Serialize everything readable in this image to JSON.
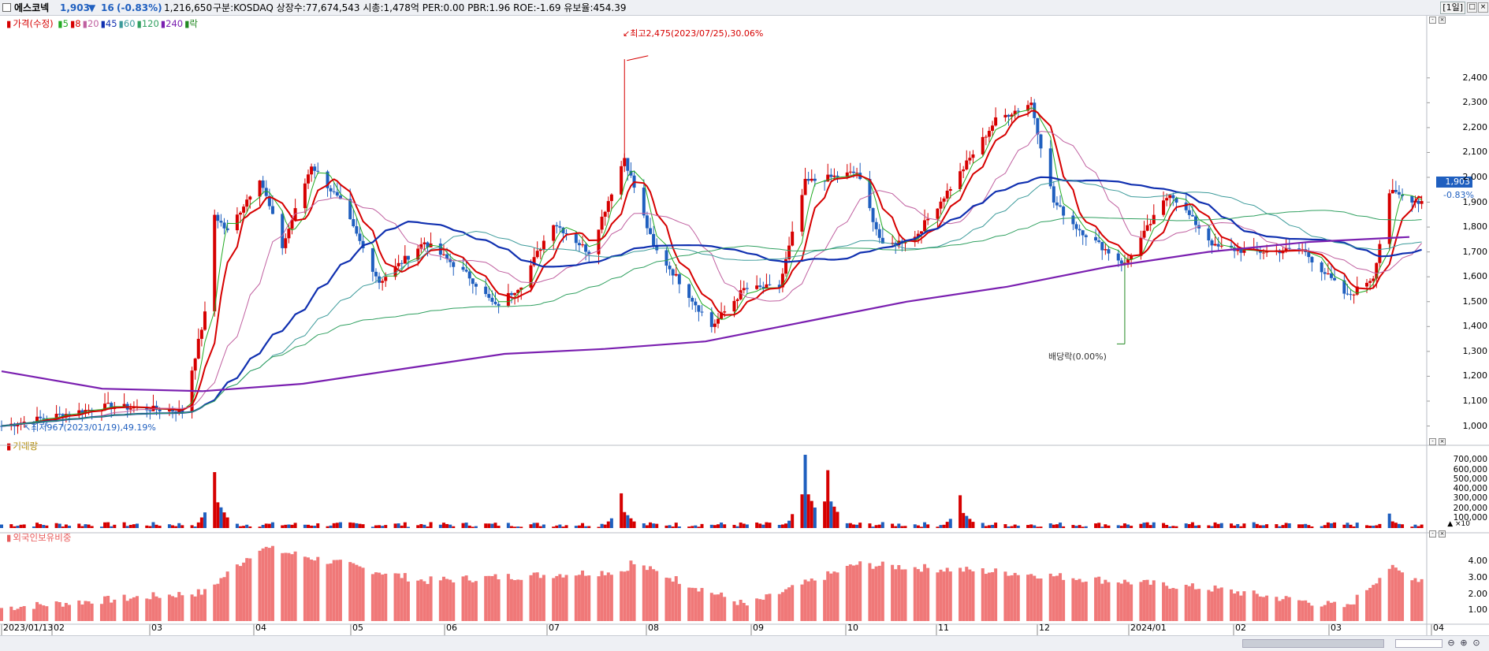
{
  "header": {
    "name": "에스코넥",
    "price": "1,903",
    "change": "16",
    "change_pct": "(-0.83%)",
    "volume": "1,216,650",
    "info": "구분:KOSDAQ 상장수:77,674,543 시총:1,478억 PER:0.00 PBR:1.96 ROE:-1.69 유보율:454.39",
    "period": "[1일]",
    "down_icon": "down-triangle-icon",
    "colors": {
      "up": "#d60000",
      "down": "#1f5fbf"
    }
  },
  "legend": {
    "price_title": "가격(수정)",
    "ma": [
      {
        "label": "5",
        "color": "#22aa22"
      },
      {
        "label": "8",
        "color": "#d60000"
      },
      {
        "label": "20",
        "color": "#c060a0"
      },
      {
        "label": "45",
        "color": "#1030b0"
      },
      {
        "label": "60",
        "color": "#3b9a9a"
      },
      {
        "label": "120",
        "color": "#30a060"
      },
      {
        "label": "240",
        "color": "#7a1fb0"
      },
      {
        "label": "락",
        "color": "#228822"
      }
    ],
    "volume_title": "거래량",
    "foreign_title": "외국인보유비중"
  },
  "annotations": {
    "high": "최고2,475(2023/07/25),30.06%",
    "low": "최저967(2023/01/19),49.19%",
    "dividend": "배당락(0.00%)",
    "current_price": "1,903",
    "current_pct": "-0.83%"
  },
  "axes": {
    "price_ticks": [
      "2,400",
      "2,300",
      "2,200",
      "2,100",
      "2,000",
      "1,900",
      "1,800",
      "1,700",
      "1,600",
      "1,500",
      "1,400",
      "1,300",
      "1,200",
      "1,100",
      "1,000"
    ],
    "volume_ticks": [
      "700,000",
      "600,000",
      "500,000",
      "400,000",
      "300,000",
      "200,000",
      "100,000"
    ],
    "volume_unit": "▲ ×10",
    "foreign_ticks": [
      "4.00",
      "3.00",
      "2.00",
      "1.00"
    ],
    "x_labels": [
      "2023/01/13",
      "02",
      "03",
      "04",
      "05",
      "06",
      "07",
      "08",
      "09",
      "10",
      "11",
      "12",
      "2024/01",
      "02",
      "03",
      "04"
    ]
  },
  "chart_data": [
    {
      "type": "candlestick",
      "title": "가격(수정)",
      "ylim": [
        950,
        2480
      ],
      "x_start": "2023/01/13",
      "x_end": "2024/03/29",
      "key_points": [
        {
          "date": "2023/01/13",
          "close": 1000
        },
        {
          "date": "2023/01/19",
          "low": 967
        },
        {
          "date": "2023/02/15",
          "close": 1080
        },
        {
          "date": "2023/03/10",
          "close": 1060
        },
        {
          "date": "2023/03/17",
          "close": 1450
        },
        {
          "date": "2023/03/20",
          "close": 1850
        },
        {
          "date": "2023/03/24",
          "close": 1780
        },
        {
          "date": "2023/04/03",
          "close": 2000
        },
        {
          "date": "2023/04/10",
          "close": 1720
        },
        {
          "date": "2023/04/19",
          "close": 2050
        },
        {
          "date": "2023/04/28",
          "close": 1900
        },
        {
          "date": "2023/05/10",
          "close": 1580
        },
        {
          "date": "2023/05/24",
          "close": 1740
        },
        {
          "date": "2023/06/07",
          "close": 1600
        },
        {
          "date": "2023/06/15",
          "close": 1480
        },
        {
          "date": "2023/06/23",
          "close": 1570
        },
        {
          "date": "2023/07/03",
          "close": 1820
        },
        {
          "date": "2023/07/14",
          "close": 1700
        },
        {
          "date": "2023/07/25",
          "high": 2475,
          "close": 2080
        },
        {
          "date": "2023/08/03",
          "close": 1720
        },
        {
          "date": "2023/08/10",
          "close": 1600
        },
        {
          "date": "2023/08/21",
          "close": 1400
        },
        {
          "date": "2023/08/31",
          "close": 1550
        },
        {
          "date": "2023/09/11",
          "close": 1560
        },
        {
          "date": "2023/09/19",
          "close": 1980
        },
        {
          "date": "2023/10/05",
          "close": 2020
        },
        {
          "date": "2023/10/13",
          "close": 1720
        },
        {
          "date": "2023/10/23",
          "close": 1760
        },
        {
          "date": "2023/11/03",
          "close": 1960
        },
        {
          "date": "2023/11/17",
          "close": 2230
        },
        {
          "date": "2023/11/28",
          "close": 2300
        },
        {
          "date": "2023/12/05",
          "close": 1900
        },
        {
          "date": "2023/12/12",
          "close": 1800
        },
        {
          "date": "2023/12/27",
          "close": 1650
        },
        {
          "date": "2024/01/10",
          "close": 1940
        },
        {
          "date": "2024/01/24",
          "close": 1720
        },
        {
          "date": "2024/02/05",
          "close": 1700
        },
        {
          "date": "2024/02/20",
          "close": 1710
        },
        {
          "date": "2024/03/05",
          "close": 1520
        },
        {
          "date": "2024/03/13",
          "close": 1600
        },
        {
          "date": "2024/03/18",
          "close": 1940
        },
        {
          "date": "2024/03/27",
          "close": 1903
        }
      ],
      "ma_lines": [
        {
          "name": "45",
          "points": [
            1020,
            1030,
            1060,
            1150,
            1340,
            1520,
            1760,
            1720,
            1630,
            1720,
            1700,
            1690,
            1770,
            1900,
            1930,
            1880,
            1730,
            1710
          ]
        },
        {
          "name": "240",
          "points": [
            1220,
            1150,
            1140,
            1170,
            1230,
            1290,
            1310,
            1340,
            1420,
            1500,
            1560,
            1640,
            1700,
            1740,
            1760
          ]
        }
      ]
    },
    {
      "type": "bar",
      "title": "거래량",
      "ylim": [
        0,
        750000
      ],
      "spikes": [
        {
          "date": "2023/03/20",
          "value": 580000
        },
        {
          "date": "2023/07/24",
          "value": 360000
        },
        {
          "date": "2023/09/19",
          "value": 760000
        },
        {
          "date": "2023/09/26",
          "value": 600000
        },
        {
          "date": "2023/11/06",
          "value": 340000
        },
        {
          "date": "2024/03/18",
          "value": 150000
        }
      ]
    },
    {
      "type": "bar",
      "title": "외국인보유비중",
      "ylim": [
        0.5,
        4.5
      ],
      "key_points": [
        {
          "date": "2023/01/13",
          "value": 1.15
        },
        {
          "date": "2023/03/17",
          "value": 2.1
        },
        {
          "date": "2023/04/03",
          "value": 4.85
        },
        {
          "date": "2023/05/24",
          "value": 2.8
        },
        {
          "date": "2023/07/25",
          "value": 3.4
        },
        {
          "date": "2023/07/27",
          "value": 3.9
        },
        {
          "date": "2023/09/01",
          "value": 1.3
        },
        {
          "date": "2023/10/05",
          "value": 3.8
        },
        {
          "date": "2023/11/22",
          "value": 3.3
        },
        {
          "date": "2024/01/24",
          "value": 2.3
        },
        {
          "date": "2024/03/05",
          "value": 1.2
        },
        {
          "date": "2024/03/18",
          "value": 3.6
        },
        {
          "date": "2024/03/27",
          "value": 2.9
        }
      ]
    }
  ]
}
